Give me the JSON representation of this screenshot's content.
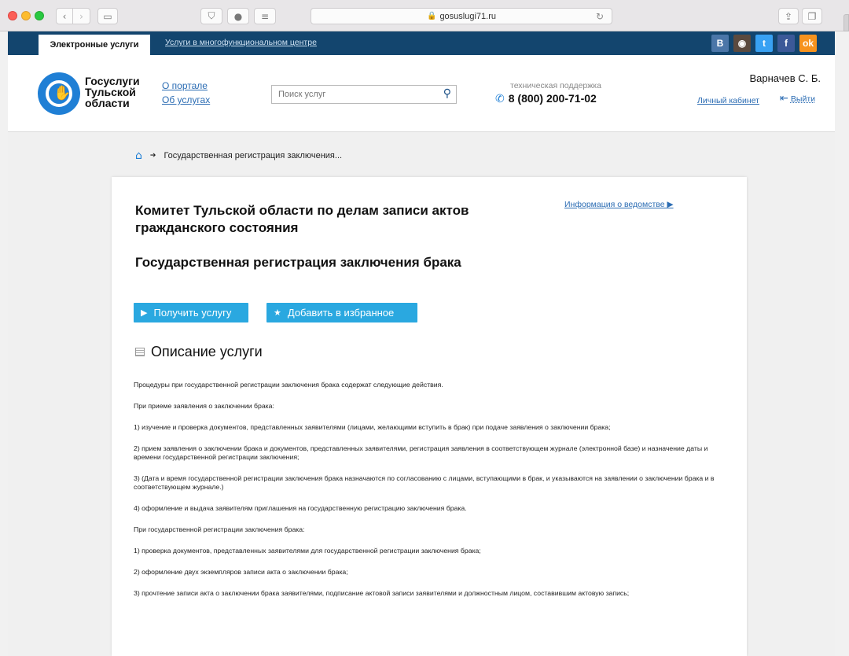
{
  "browser": {
    "url": "gosuslugi71.ru"
  },
  "topbar": {
    "tab_active": "Электронные услуги",
    "tab_link": "Услуги в многофункциональном центре",
    "social": [
      "B",
      "◉",
      "t",
      "f",
      "ok"
    ]
  },
  "header": {
    "logo_lines": [
      "Госуслуги",
      "Тульской",
      "области"
    ],
    "links": [
      "О портале",
      "Об услугах"
    ],
    "search_placeholder": "Поиск услуг",
    "support_label": "техническая поддержка",
    "phone": "8 (800) 200-71-02",
    "user_name": "Варначев С. Б.",
    "cabinet": "Личный кабинет",
    "logout": "Выйти"
  },
  "breadcrumb": {
    "current": "Государственная регистрация заключения..."
  },
  "card": {
    "dept_title": "Комитет Тульской области по делам записи актов гражданского состояния",
    "info_link": "Информация о ведомстве ▶",
    "service_title": "Государственная регистрация заключения брака",
    "btn_get": "Получить услугу",
    "btn_fav": "Добавить в избранное",
    "desc_heading": "Описание услуги",
    "paragraphs": [
      "Процедуры при государственной регистрации заключения брака содержат следующие действия.",
      "При приеме заявления о заключении брака:",
      "1) изучение и проверка документов, представленных заявителями (лицами, желающими вступить в брак) при подаче заявления о заключении брака;",
      "2) прием заявления о заключении брака и документов, представленных заявителями, регистрация заявления в соответствующем журнале (электронной базе) и назначение даты и времени государственной регистрации заключения;",
      "3) (Дата и время государственной регистрации заключения брака назначаются по согласованию с лицами, вступающими в брак, и указываются на заявлении о заключении брака и в соответствующем журнале.)",
      "4) оформление и выдача заявителям приглашения на государственную регистрацию заключения брака.",
      "При государственной регистрации заключения брака:",
      "1) проверка документов, представленных заявителями для государственной регистрации заключения брака;",
      "2) оформление двух экземпляров записи акта о заключении брака;",
      "3) прочтение записи акта о заключении брака заявителями, подписание актовой записи заявителями и должностным лицом, составившим актовую запись;"
    ]
  },
  "colors": {
    "topbar": "#13456e",
    "accent": "#2aa8e0",
    "link": "#2b6cb3",
    "logo": "#1f7fd5"
  }
}
